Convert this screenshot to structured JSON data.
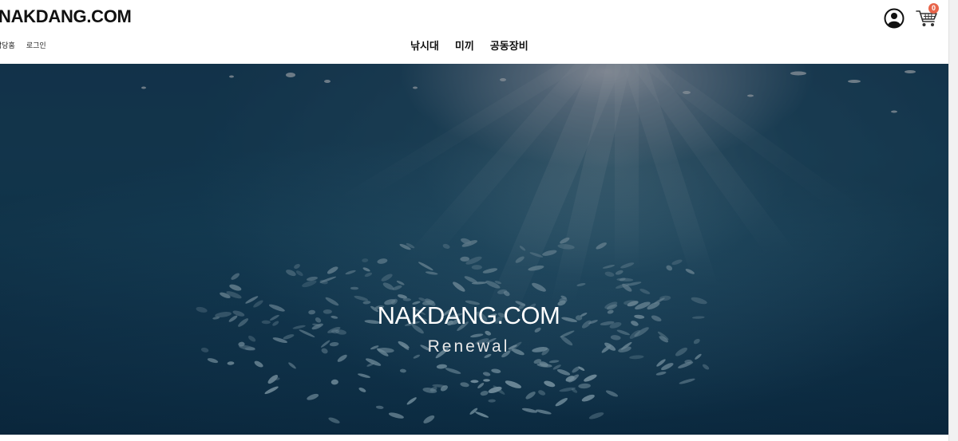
{
  "header": {
    "logo": "NAKDANG.COM",
    "util_links": [
      "낙당홈",
      "로그인"
    ],
    "nav": [
      "낚시대",
      "미끼",
      "공동장비"
    ],
    "user_icon": "user-circle-icon",
    "cart_icon": "shopping-cart-icon",
    "cart_count": "0",
    "badge_color": "#e8644a"
  },
  "hero": {
    "title": "NAKDANG.COM",
    "subtitle": "Renewal",
    "background": "underwater-sunrays-fish-school"
  }
}
